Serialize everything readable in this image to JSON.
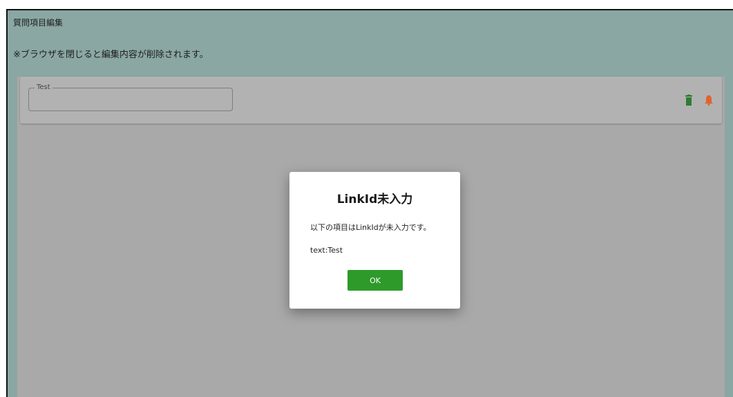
{
  "page": {
    "title": "質問項目編集",
    "notice": "※ブラウザを閉じると編集内容が削除されます。"
  },
  "question_card": {
    "field_label": "Test",
    "field_value": "",
    "actions": [
      {
        "icon": "trash-icon",
        "color": "#2e7d32"
      },
      {
        "icon": "bell-icon",
        "color": "#e0632b"
      }
    ]
  },
  "dialog": {
    "title": "LinkId未入力",
    "message": "以下の項目はLinkIdが未入力です。",
    "item": "text:Test",
    "ok_label": "OK"
  },
  "colors": {
    "overlay_bg": "#a9a9a9",
    "page_bg": "#8aa7a3",
    "ok_button": "#2e9a2a",
    "trash": "#2e7d32",
    "bell": "#e0632b"
  }
}
